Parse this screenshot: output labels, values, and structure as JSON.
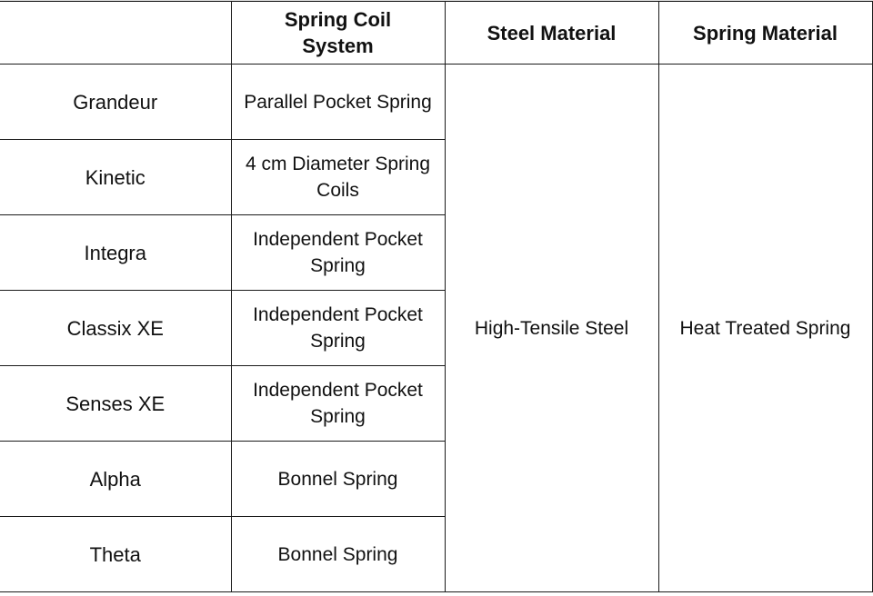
{
  "table": {
    "headers": [
      "",
      "Spring Coil System",
      "Steel Material",
      "Spring Material"
    ],
    "rows": [
      {
        "model": "Grandeur",
        "spring_coil_system": "Parallel Pocket Spring"
      },
      {
        "model": "Kinetic",
        "spring_coil_system": "4 cm Diameter Spring Coils"
      },
      {
        "model": "Integra",
        "spring_coil_system": "Independent Pocket Spring"
      },
      {
        "model": "Classix XE",
        "spring_coil_system": "Independent Pocket Spring"
      },
      {
        "model": "Senses XE",
        "spring_coil_system": "Independent Pocket Spring"
      },
      {
        "model": "Alpha",
        "spring_coil_system": "Bonnel Spring"
      },
      {
        "model": "Theta",
        "spring_coil_system": "Bonnel Spring"
      }
    ],
    "steel_material_all": "High-Tensile Steel",
    "spring_material_all": "Heat Treated Spring"
  },
  "colors": {
    "border": "#1a1a1a",
    "text": "#111111",
    "background": "#ffffff"
  }
}
